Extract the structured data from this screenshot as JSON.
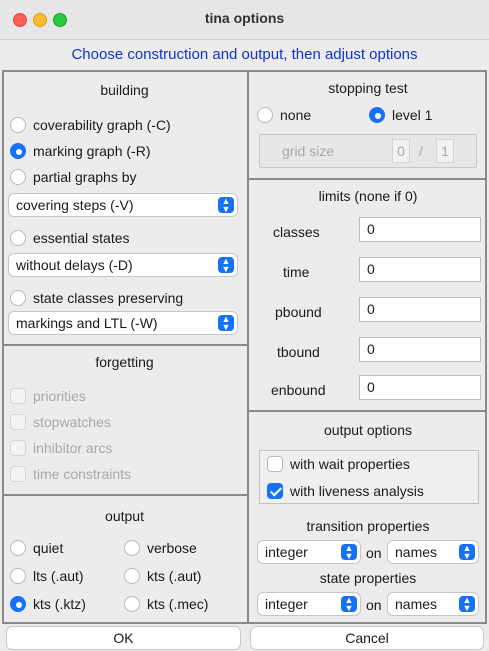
{
  "window": {
    "title": "tina options"
  },
  "banner": "Choose construction and output, then adjust options",
  "building": {
    "title": "building",
    "coverability": "coverability graph (-C)",
    "marking": "marking graph (-R)",
    "partial": "partial graphs by",
    "partial_select": "covering steps (-V)",
    "essential": "essential states",
    "essential_select": "without delays (-D)",
    "classes": "state classes preserving",
    "classes_select": "markings and LTL (-W)"
  },
  "forgetting": {
    "title": "forgetting",
    "items": [
      "priorities",
      "stopwatches",
      "inhibitor arcs",
      "time constraints"
    ]
  },
  "output": {
    "title": "output",
    "quiet": "quiet",
    "verbose": "verbose",
    "lts": "lts (.aut)",
    "kts_aut": "kts (.aut)",
    "kts_ktz": "kts (.ktz)",
    "kts_mec": "kts (.mec)"
  },
  "stopping": {
    "title": "stopping test",
    "none": "none",
    "level": "level 1",
    "grid_label": "grid size",
    "grid_a": "0",
    "grid_sep": "/",
    "grid_b": "1"
  },
  "limits": {
    "title": "limits (none if 0)",
    "classes_label": "classes",
    "classes_value": "0",
    "time_label": "time",
    "time_value": "0",
    "pbound_label": "pbound",
    "pbound_value": "0",
    "tbound_label": "tbound",
    "tbound_value": "0",
    "enbound_label": "enbound",
    "enbound_value": "0"
  },
  "output_options": {
    "title": "output options",
    "wait": "with wait properties",
    "liveness": "with liveness analysis",
    "transition_title": "transition properties",
    "transition_type": "integer",
    "on1": "on",
    "transition_names": "names",
    "state_title": "state properties",
    "state_type": "integer",
    "on2": "on",
    "state_names": "names"
  },
  "buttons": {
    "ok": "OK",
    "cancel": "Cancel"
  },
  "colors": {
    "accent": "#1672f3",
    "banner": "#1133cc"
  }
}
